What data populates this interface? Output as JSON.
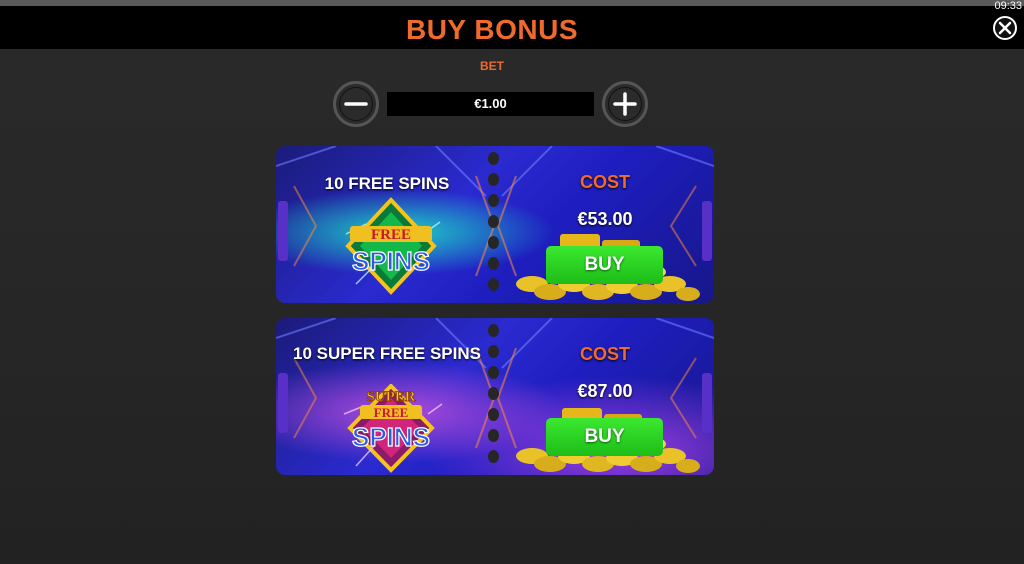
{
  "header": {
    "title": "BUY BONUS",
    "clock": "09:33"
  },
  "bet": {
    "label": "BET",
    "value": "€1.00"
  },
  "offers": [
    {
      "title": "10 FREE SPINS",
      "logo_lines": [
        "FREE",
        "SPINS"
      ],
      "cost_label": "COST",
      "price": "€53.00",
      "buy_label": "BUY"
    },
    {
      "title": "10 SUPER FREE SPINS",
      "logo_lines": [
        "SUPER",
        "FREE",
        "SPINS"
      ],
      "cost_label": "COST",
      "price": "€87.00",
      "buy_label": "BUY"
    }
  ],
  "colors": {
    "accent": "#ef6a2c",
    "buy": "#2bd323",
    "card": "#2a2ad0"
  },
  "icons": {
    "close": "close-icon",
    "minus": "minus-icon",
    "plus": "plus-icon"
  }
}
